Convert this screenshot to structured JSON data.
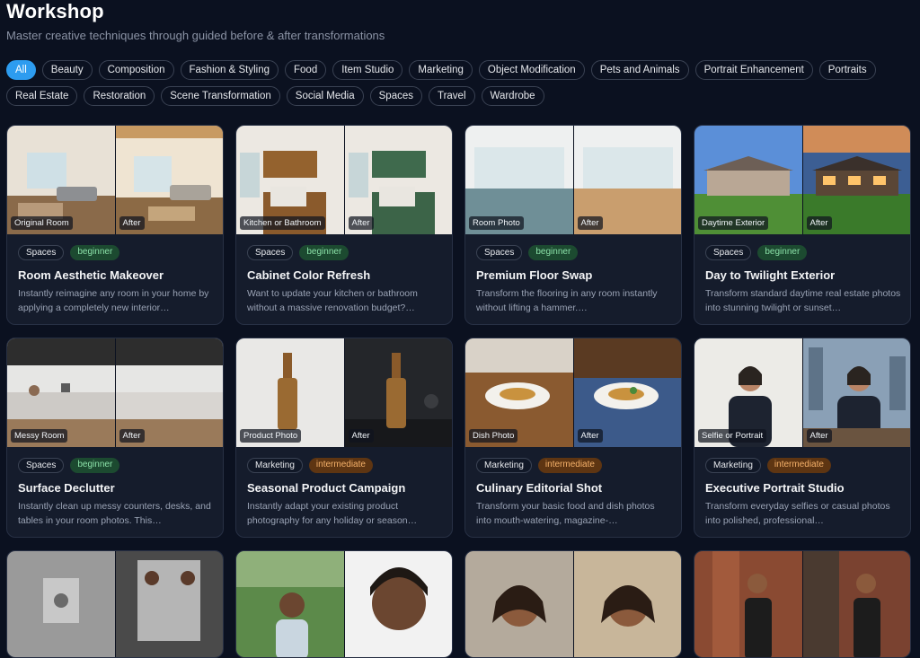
{
  "header": {
    "title": "Workshop",
    "subtitle": "Master creative techniques through guided before & after transformations"
  },
  "filters": [
    "All",
    "Beauty",
    "Composition",
    "Fashion & Styling",
    "Food",
    "Item Studio",
    "Marketing",
    "Object Modification",
    "Pets and Animals",
    "Portrait Enhancement",
    "Portraits",
    "Real Estate",
    "Restoration",
    "Scene Transformation",
    "Social Media",
    "Spaces",
    "Travel",
    "Wardrobe"
  ],
  "active_filter": "All",
  "colors": {
    "accent": "#2d9cf0",
    "beginner": "#8be1a8",
    "intermediate": "#f6b26b",
    "background": "#0b1120",
    "card": "#151c2c"
  },
  "cards": [
    {
      "before_label": "Original Room",
      "after_label": "After",
      "category": "Spaces",
      "level": "beginner",
      "title": "Room Aesthetic Makeover",
      "description": "Instantly reimagine any room in your home by applying a completely new interior…"
    },
    {
      "before_label": "Kitchen or Bathroom",
      "after_label": "After",
      "category": "Spaces",
      "level": "beginner",
      "title": "Cabinet Color Refresh",
      "description": "Want to update your kitchen or bathroom without a massive renovation budget?…"
    },
    {
      "before_label": "Room Photo",
      "after_label": "After",
      "category": "Spaces",
      "level": "beginner",
      "title": "Premium Floor Swap",
      "description": "Transform the flooring in any room instantly without lifting a hammer.…"
    },
    {
      "before_label": "Daytime Exterior",
      "after_label": "After",
      "category": "Spaces",
      "level": "beginner",
      "title": "Day to Twilight Exterior",
      "description": "Transform standard daytime real estate photos into stunning twilight or sunset…"
    },
    {
      "before_label": "Messy Room",
      "after_label": "After",
      "category": "Spaces",
      "level": "beginner",
      "title": "Surface Declutter",
      "description": "Instantly clean up messy counters, desks, and tables in your room photos. This…"
    },
    {
      "before_label": "Product Photo",
      "after_label": "After",
      "category": "Marketing",
      "level": "intermediate",
      "title": "Seasonal Product Campaign",
      "description": "Instantly adapt your existing product photography for any holiday or season…"
    },
    {
      "before_label": "Dish Photo",
      "after_label": "After",
      "category": "Marketing",
      "level": "intermediate",
      "title": "Culinary Editorial Shot",
      "description": "Transform your basic food and dish photos into mouth-watering, magazine-…"
    },
    {
      "before_label": "Selfie or Portrait",
      "after_label": "After",
      "category": "Marketing",
      "level": "intermediate",
      "title": "Executive Portrait Studio",
      "description": "Transform everyday selfies or casual photos into polished, professional…"
    }
  ]
}
